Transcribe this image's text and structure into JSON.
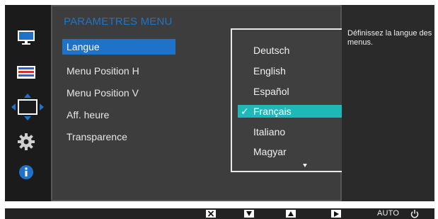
{
  "menu": {
    "title": "PARAMETRES MENU",
    "items": [
      {
        "label": "Langue",
        "selected": true
      },
      {
        "label": "Menu Position H",
        "selected": false
      },
      {
        "label": "Menu Position V",
        "selected": false
      },
      {
        "label": "Aff. heure",
        "selected": false
      },
      {
        "label": "Transparence",
        "selected": false
      }
    ]
  },
  "languages": {
    "items": [
      {
        "label": "Deutsch",
        "selected": false
      },
      {
        "label": "English",
        "selected": false
      },
      {
        "label": "Español",
        "selected": false
      },
      {
        "label": "Français",
        "selected": true
      },
      {
        "label": "Italiano",
        "selected": false
      },
      {
        "label": "Magyar",
        "selected": false
      }
    ],
    "scroll_indicator": "chevron-down"
  },
  "help": {
    "text": "Définissez la langue des menus."
  },
  "sidebar": {
    "icons": [
      "monitor-icon",
      "color-bars-icon",
      "move-arrows-icon",
      "gear-icon",
      "info-icon"
    ],
    "active_index": 2
  },
  "bottom_bar": {
    "buttons": [
      "close-icon",
      "down-arrow-icon",
      "up-arrow-icon",
      "right-arrow-icon",
      "auto-button",
      "power-icon"
    ],
    "auto_label": "AUTO"
  },
  "colors": {
    "accent_blue": "#1e73c9",
    "selection_teal": "#1db8b8",
    "background_dark": "#1e1e1e"
  }
}
